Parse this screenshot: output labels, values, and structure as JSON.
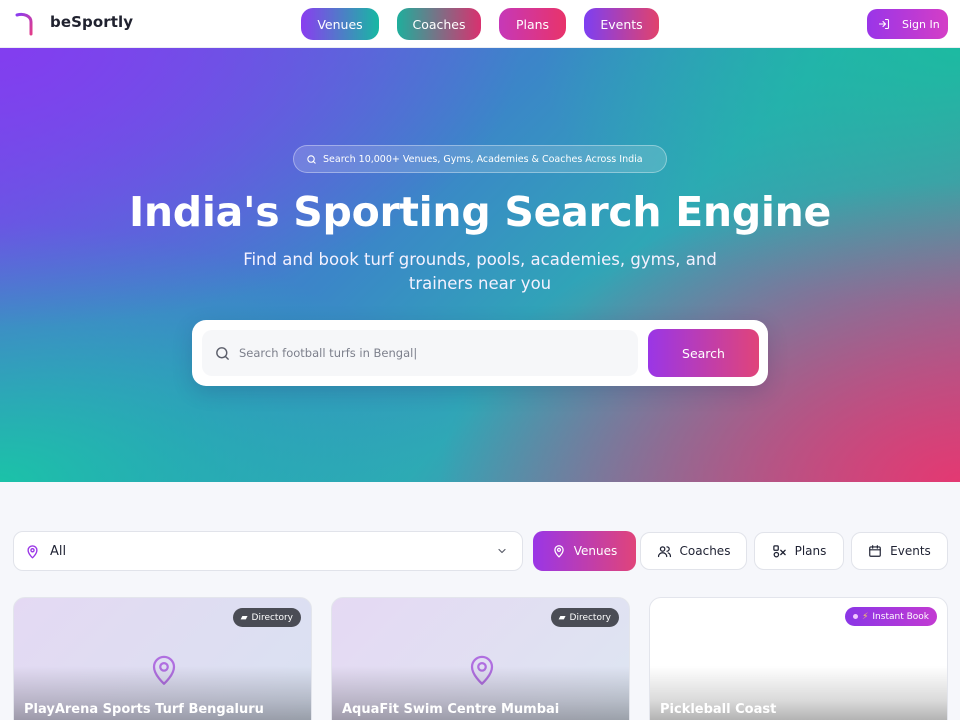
{
  "header": {
    "brand": "beSportly",
    "nav": [
      "Venues",
      "Coaches",
      "Plans",
      "Events"
    ],
    "sign_in": "Sign In"
  },
  "hero": {
    "pill_text": "Search 10,000+ Venues, Gyms, Academies & Coaches Across India",
    "title": "India's Sporting Search Engine",
    "subtitle": "Find and book turf grounds, pools, academies, gyms, and trainers near you",
    "search_placeholder": "Search football turfs in Bengal|",
    "search_button": "Search"
  },
  "filters": {
    "location_value": "All",
    "categories": [
      "Venues",
      "Coaches",
      "Plans",
      "Events"
    ],
    "active_category": "Venues"
  },
  "cards": [
    {
      "badge": "Directory",
      "title": "PlayArena Sports Turf Bengaluru"
    },
    {
      "badge": "Directory",
      "title": "AquaFit Swim Centre Mumbai"
    },
    {
      "badge": "Instant Book",
      "title": "Pickleball Coast"
    }
  ],
  "colors": {
    "accent_purple": "#9a36e6",
    "accent_pink": "#e0447a",
    "accent_teal": "#17b8a2"
  }
}
